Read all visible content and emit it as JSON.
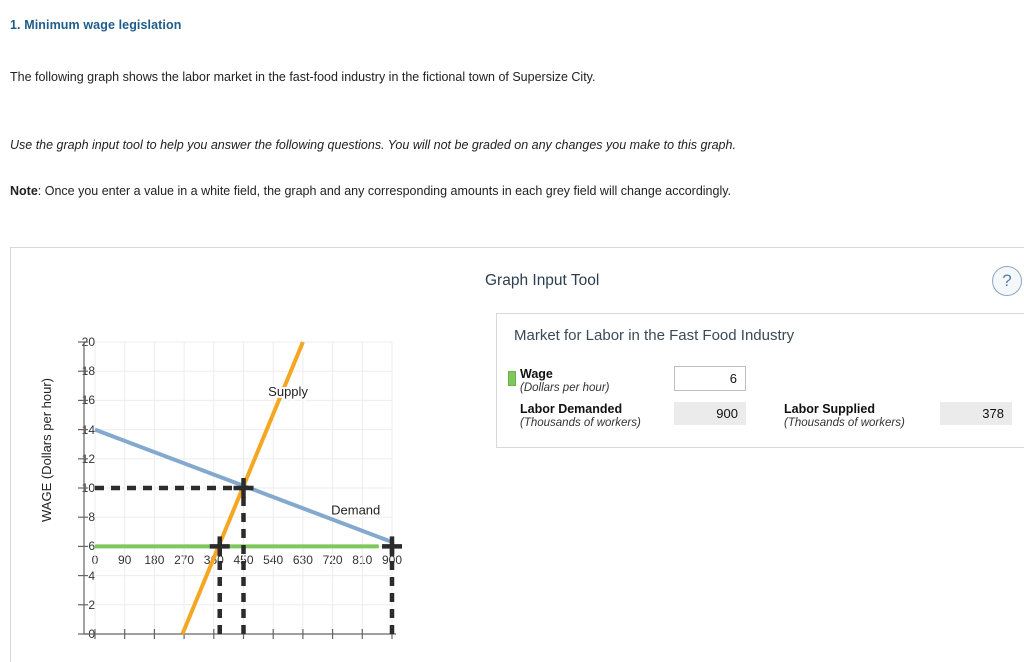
{
  "question": {
    "title": "1. Minimum wage legislation",
    "para1": "The following graph shows the labor market in the fast-food industry in the fictional town of Supersize City.",
    "para2": "Use the graph input tool to help you answer the following questions. You will not be graded on any changes you make to this graph.",
    "note_label": "Note",
    "note_rest": ": Once you enter a value in a white field, the graph and any corresponding amounts in each grey field will change accordingly."
  },
  "graph_input_tool": {
    "title": "Graph Input Tool",
    "help_icon": "question-mark-icon",
    "help_glyph": "?",
    "market_title": "Market for Labor in the Fast Food Industry",
    "wage": {
      "label": "Wage",
      "units": "(Dollars per hour)",
      "value": "6",
      "swatch_color": "#7cc85c"
    },
    "labor_demanded": {
      "label": "Labor Demanded",
      "units": "(Thousands of workers)",
      "value": "900"
    },
    "labor_supplied": {
      "label": "Labor Supplied",
      "units": "(Thousands of workers)",
      "value": "378"
    }
  },
  "chart_data": {
    "type": "line",
    "title": "",
    "xlabel": "",
    "ylabel": "WAGE (Dollars per hour)",
    "xlim": [
      0,
      900
    ],
    "ylim": [
      0,
      20
    ],
    "xticks": [
      0,
      90,
      180,
      270,
      360,
      450,
      540,
      630,
      720,
      810,
      900
    ],
    "yticks": [
      0,
      2,
      4,
      6,
      8,
      10,
      12,
      14,
      16,
      18,
      20
    ],
    "grid": true,
    "legend_position": "inline-labels",
    "series": [
      {
        "name": "Supply",
        "color": "#f5a623",
        "label": "Supply",
        "label_x": 585,
        "label_y": 16.3,
        "points": [
          [
            265,
            0
          ],
          [
            630,
            20
          ]
        ]
      },
      {
        "name": "Demand",
        "color": "#83a9cf",
        "label": "Demand",
        "label_x": 790,
        "label_y": 8.2,
        "points": [
          [
            0,
            14
          ],
          [
            900,
            6.3
          ]
        ]
      },
      {
        "name": "Wage line",
        "color": "#7cc85c",
        "label": "",
        "points": [
          [
            0,
            6
          ],
          [
            860,
            6
          ]
        ]
      }
    ],
    "markers": [
      {
        "name": "supply-at-wage",
        "x": 378,
        "y": 6
      },
      {
        "name": "equilibrium",
        "x": 450,
        "y": 10
      },
      {
        "name": "demand-at-wage",
        "x": 900,
        "y": 6
      }
    ],
    "guide_lines": [
      {
        "name": "equilibrium-wage-guide",
        "from": [
          0,
          10
        ],
        "to": [
          450,
          10
        ]
      },
      {
        "name": "equilibrium-quantity-guide",
        "from": [
          450,
          0
        ],
        "to": [
          450,
          10
        ]
      },
      {
        "name": "labor-supplied-guide",
        "from": [
          378,
          0
        ],
        "to": [
          378,
          6
        ]
      },
      {
        "name": "labor-demanded-guide",
        "from": [
          900,
          0
        ],
        "to": [
          900,
          6
        ]
      }
    ]
  }
}
